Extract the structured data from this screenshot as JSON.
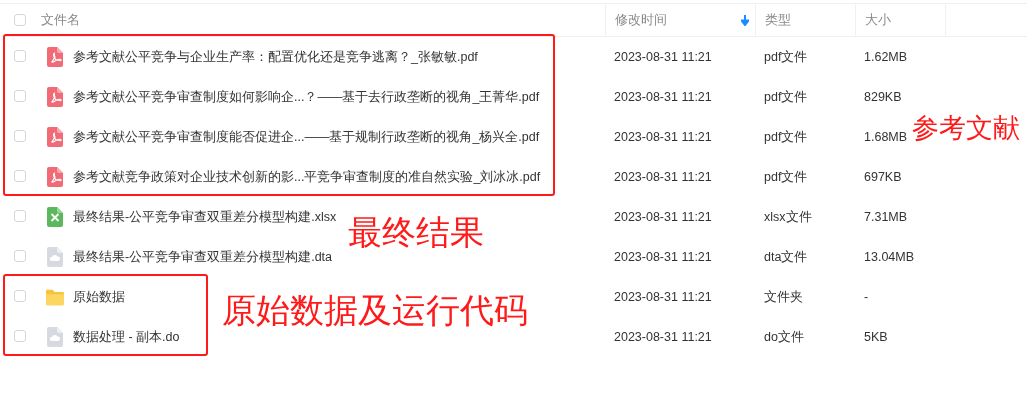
{
  "header": {
    "checked": false,
    "columns": [
      {
        "label": "文件名",
        "sorted": false
      },
      {
        "label": "修改时间",
        "sorted": true
      },
      {
        "label": "类型",
        "sorted": false
      },
      {
        "label": "大小",
        "sorted": false
      }
    ]
  },
  "files": [
    {
      "kind": "pdf",
      "checked": false,
      "name": "参考文献公平竞争与企业生产率：配置优化还是竞争逃离？_张敏敏.pdf",
      "modified": "2023-08-31 11:21",
      "type": "pdf文件",
      "size": "1.62MB"
    },
    {
      "kind": "pdf",
      "checked": false,
      "name": "参考文献公平竞争审查制度如何影响企...？——基于去行政垄断的视角_王菁华.pdf",
      "modified": "2023-08-31 11:21",
      "type": "pdf文件",
      "size": "829KB"
    },
    {
      "kind": "pdf",
      "checked": false,
      "name": "参考文献公平竞争审查制度能否促进企...——基于规制行政垄断的视角_杨兴全.pdf",
      "modified": "2023-08-31 11:21",
      "type": "pdf文件",
      "size": "1.68MB"
    },
    {
      "kind": "pdf",
      "checked": false,
      "name": "参考文献竞争政策对企业技术创新的影...平竞争审查制度的准自然实验_刘冰冰.pdf",
      "modified": "2023-08-31 11:21",
      "type": "pdf文件",
      "size": "697KB"
    },
    {
      "kind": "xlsx",
      "checked": false,
      "name": "最终结果-公平竞争审查双重差分模型构建.xlsx",
      "modified": "2023-08-31 11:21",
      "type": "xlsx文件",
      "size": "7.31MB"
    },
    {
      "kind": "file",
      "checked": false,
      "name": "最终结果-公平竞争审查双重差分模型构建.dta",
      "modified": "2023-08-31 11:21",
      "type": "dta文件",
      "size": "13.04MB"
    },
    {
      "kind": "folder",
      "checked": false,
      "name": "原始数据",
      "modified": "2023-08-31 11:21",
      "type": "文件夹",
      "size": "-"
    },
    {
      "kind": "file",
      "checked": false,
      "name": "数据处理 - 副本.do",
      "modified": "2023-08-31 11:21",
      "type": "do文件",
      "size": "5KB"
    }
  ],
  "annotations": [
    {
      "text": "参考文献",
      "boxed": true
    },
    {
      "text": "最终结果",
      "boxed": false
    },
    {
      "text": "原始数据及运行代码",
      "boxed": true
    }
  ]
}
